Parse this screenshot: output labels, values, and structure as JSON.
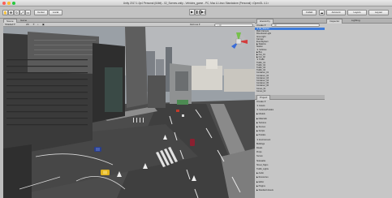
{
  "window": {
    "title": "Unity 2017.1.0p4 Personal (64bit) - 02_Scenes.unity - Vehicles_game - PC, Mac & Linux Standalone (Personal) <OpenGL 4.1>"
  },
  "toolbar": {
    "tools": [
      "hand-icon",
      "move-icon",
      "rotate-icon",
      "scale-icon",
      "rect-icon"
    ],
    "pivot_label": "Center",
    "space_label": "Local",
    "play_controls": [
      "play-icon",
      "pause-icon",
      "step-icon"
    ],
    "collab_label": "Collab",
    "account_label": "Account",
    "layers_label": "Layers",
    "layout_label": "Layout"
  },
  "scene": {
    "tab_scene": "Scene",
    "tab_game": "Game",
    "shading_mode": "Shaded",
    "view_mode": "2D",
    "gizmos_label": "Gizmos",
    "search_placeholder": "All",
    "gizmo_axes": [
      "x",
      "y",
      "z"
    ],
    "gizmo_mode": "Persp"
  },
  "hierarchy": {
    "tab_label": "Hierarchy",
    "create_label": "Create",
    "search_placeholder": "All",
    "items": [
      "▼ 02_Scenes",
      "  Main Camera",
      "  Directional Light",
      "  Area Light",
      "  Canvas",
      "  EventSystem",
      "▶ Stations",
      "  Station",
      "▼ Vehicles",
      "  ▶ Bus",
      "  ▶ Car_01",
      "  ▶ Car_02",
      "▼ Traffic",
      "  Traffic_01",
      "  Traffic_02",
      "  Traffic_03",
      "  Traffic_04",
      "  Container_01",
      "  Container_02",
      "  Container_03",
      "  Container_04",
      "  Container_05",
      "  Container_06",
      "  Cones_01",
      "  Cones_02"
    ]
  },
  "project": {
    "tab_label": "Project",
    "create_label": "Create",
    "items": [
      "▼ Assets",
      "  ▼ VehiclesPrefabs",
      "    ▶ Models",
      "    ▶ Materials",
      "    ▶ Textures",
      "  ▶ Scenes",
      "  ▶ Scripts",
      "  ▶ Prefabs",
      "  ▼ Environment",
      "    Buildings",
      "    Roads",
      "    Props",
      "    Terrain",
      "    Sidewalks",
      "    Street_Signs",
      "    Traffic_Lights",
      "  ▶ Audio",
      "  ▶ Resources",
      "  ▶ Editor",
      "  ▶ Plugins",
      "  ▶ Standard Assets"
    ]
  },
  "inspector": {
    "tab_label": "Inspector",
    "lighting_label": "Lighting"
  },
  "colors": {
    "selection": "#3d7bd9",
    "asphalt": "#464646",
    "sky": "#b7b9bc"
  }
}
